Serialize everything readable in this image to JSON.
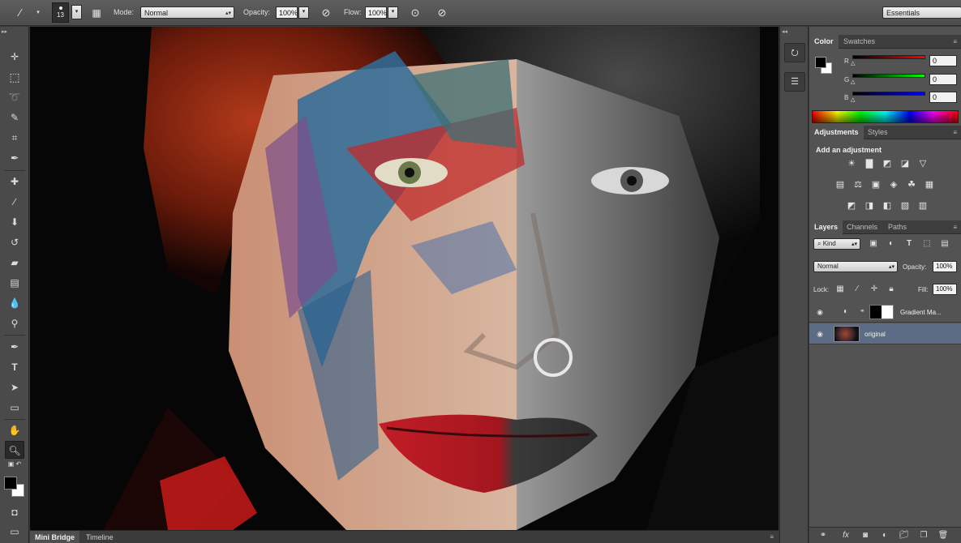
{
  "options_bar": {
    "brush_size": "13",
    "mode_label": "Mode:",
    "mode_value": "Normal",
    "opacity_label": "Opacity:",
    "opacity_value": "100%",
    "flow_label": "Flow:",
    "flow_value": "100%",
    "workspace": "Essentials"
  },
  "toolbar": {
    "tools": [
      "move-icon",
      "marquee-icon",
      "lasso-icon",
      "quick-select-icon",
      "crop-icon",
      "eyedropper-icon",
      "healing-icon",
      "brush-icon",
      "stamp-icon",
      "history-brush-icon",
      "eraser-icon",
      "gradient-icon",
      "blur-icon",
      "dodge-icon",
      "pen-icon",
      "type-icon",
      "path-select-icon",
      "shape-icon",
      "hand-icon",
      "zoom-icon"
    ],
    "active_tool": "zoom-icon"
  },
  "bottom_bar": {
    "tabs": [
      "Mini Bridge",
      "Timeline"
    ]
  },
  "color_panel": {
    "tabs": [
      "Color",
      "Swatches"
    ],
    "channels": [
      {
        "label": "R",
        "value": "0",
        "gradient": "#ff0000"
      },
      {
        "label": "G",
        "value": "0",
        "gradient": "#00ff00"
      },
      {
        "label": "B",
        "value": "0",
        "gradient": "#0000ff"
      }
    ],
    "foreground": "#000000",
    "background": "#ffffff"
  },
  "adjustments_panel": {
    "tabs": [
      "Adjustments",
      "Styles"
    ],
    "title": "Add an adjustment"
  },
  "layers_panel": {
    "tabs": [
      "Layers",
      "Channels",
      "Paths"
    ],
    "filter_kind": "Kind",
    "blend_mode": "Normal",
    "opacity_label": "Opacity:",
    "opacity_value": "100%",
    "lock_label": "Lock:",
    "fill_label": "Fill:",
    "fill_value": "100%",
    "layers": [
      {
        "name": "Gradient Ma...",
        "type": "adjustment",
        "selected": false
      },
      {
        "name": "original",
        "type": "image",
        "selected": true
      }
    ]
  },
  "colors": {
    "selected_layer": "#5b6c84",
    "panel_bg": "#535353"
  }
}
